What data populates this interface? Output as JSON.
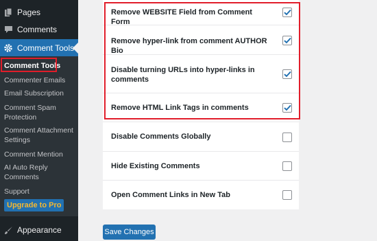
{
  "sidebar": {
    "top_items": [
      {
        "label": "Pages",
        "icon": "pages-icon"
      },
      {
        "label": "Comments",
        "icon": "comments-icon"
      }
    ],
    "active_item": {
      "label": "Comment Tools",
      "icon": "gear-icon"
    },
    "submenu": [
      {
        "label": "Comment Tools",
        "current": true
      },
      {
        "label": "Commenter Emails"
      },
      {
        "label": "Email Subscription"
      },
      {
        "label": "Comment Spam Protection"
      },
      {
        "label": "Comment Attachment Settings"
      },
      {
        "label": "Comment Mention"
      },
      {
        "label": "AI Auto Reply Comments"
      },
      {
        "label": "Support"
      }
    ],
    "upgrade_label": "Upgrade to Pro",
    "bottom_item": {
      "label": "Appearance",
      "icon": "brush-icon"
    }
  },
  "settings": [
    {
      "label": "Remove WEBSITE Field from Comment Form",
      "checked": true
    },
    {
      "label": "Remove hyper-link from comment AUTHOR Bio",
      "checked": true
    },
    {
      "label": "Disable turning URLs into hyper-links in comments",
      "checked": true
    },
    {
      "label": "Remove HTML Link Tags in comments",
      "checked": true
    },
    {
      "label": "Disable Comments Globally",
      "checked": false
    },
    {
      "label": "Hide Existing Comments",
      "checked": false
    },
    {
      "label": "Open Comment Links in New Tab",
      "checked": false
    }
  ],
  "save_label": "Save Changes",
  "colors": {
    "accent": "#2271b1",
    "highlight_border": "#e11d2a",
    "sidebar_bg": "#1d2327"
  }
}
